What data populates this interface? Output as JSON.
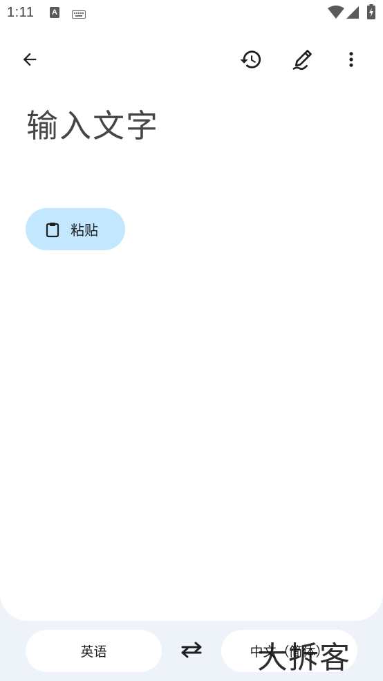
{
  "status_bar": {
    "time": "1:11",
    "a_icon_letter": "A",
    "icons": [
      "text-a-icon",
      "keyboard-icon",
      "wifi-icon",
      "signal-icon",
      "battery-charging-icon"
    ]
  },
  "toolbar": {
    "back_icon": "arrow-back-icon",
    "history_icon": "history-icon",
    "handwrite_icon": "handwriting-icon",
    "more_icon": "more-vert-icon"
  },
  "input": {
    "placeholder": "输入文字"
  },
  "paste_chip": {
    "label": "粘贴",
    "icon": "clipboard-icon",
    "color": "#c2e7ff"
  },
  "language_bar": {
    "source_language": "英语",
    "target_language": "中文（简体）",
    "swap_icon": "swap-arrows-icon"
  },
  "watermark": {
    "text": "大拆客"
  },
  "colors": {
    "background": "#eef2f9",
    "surface": "#ffffff",
    "chip": "#c2e7ff",
    "icon": "#444746"
  }
}
